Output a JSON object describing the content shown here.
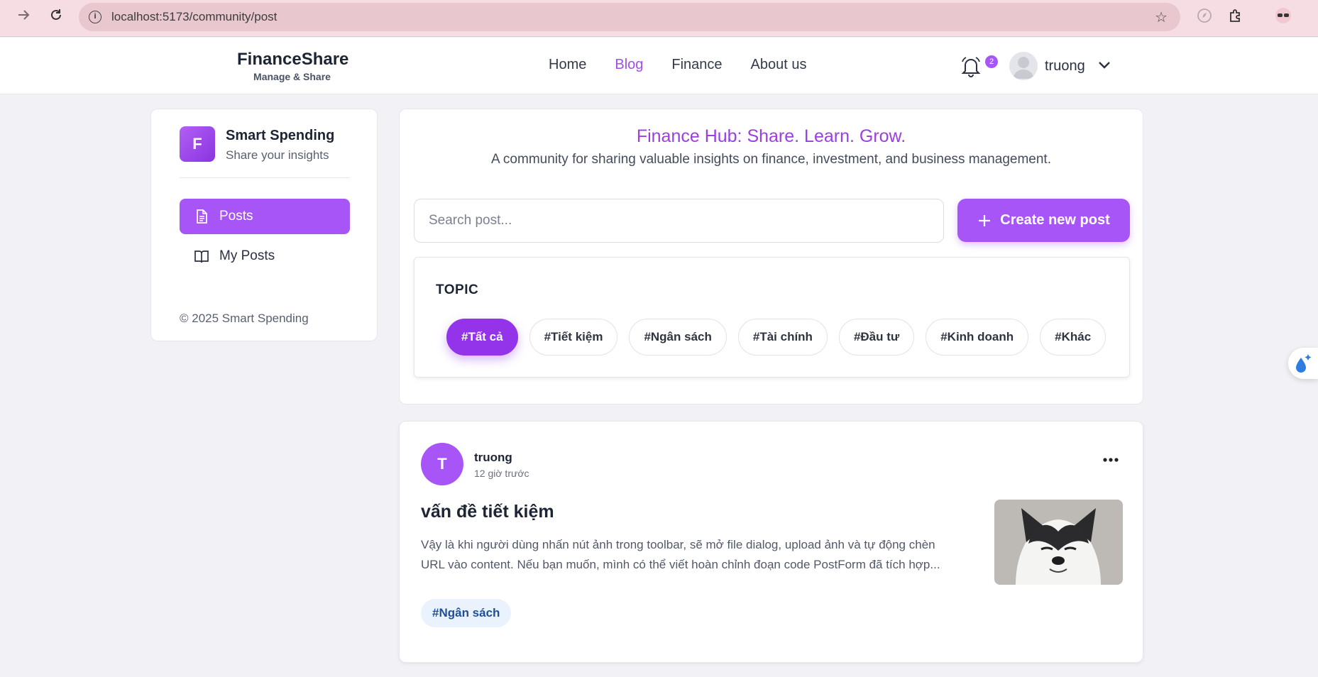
{
  "browser": {
    "url": "localhost:5173/community/post",
    "icons": [
      "forward-icon",
      "reload-icon",
      "site-info-icon",
      "bookmark-star-icon",
      "extension-icon",
      "puzzle-icon",
      "profile-icon"
    ]
  },
  "header": {
    "brand_name": "FinanceShare",
    "brand_tagline": "Manage & Share",
    "nav": [
      {
        "label": "Home",
        "active": false
      },
      {
        "label": "Blog",
        "active": true
      },
      {
        "label": "Finance",
        "active": false
      },
      {
        "label": "About us",
        "active": false
      }
    ],
    "notification_count": "2",
    "username": "truong"
  },
  "sidebar": {
    "logo_letter": "F",
    "title": "Smart Spending",
    "subtitle": "Share your insights",
    "items": [
      {
        "label": "Posts",
        "icon": "document-icon",
        "active": true
      },
      {
        "label": "My Posts",
        "icon": "open-book-icon",
        "active": false
      }
    ],
    "footer": "© 2025 Smart Spending"
  },
  "hero": {
    "title": "Finance Hub: Share. Learn. Grow.",
    "subtitle": "A community for sharing valuable insights on finance, investment, and business management.",
    "search_placeholder": "Search post...",
    "create_label": "Create new post",
    "topic_label": "TOPIC",
    "topics": [
      "#Tất cả",
      "#Tiết kiệm",
      "#Ngân sách",
      "#Tài chính",
      "#Đầu tư",
      "#Kinh doanh",
      "#Khác"
    ],
    "active_topic": "#Tất cả"
  },
  "post": {
    "avatar_letter": "T",
    "author": "truong",
    "time": "12 giờ trước",
    "title": "vấn đề tiết kiệm",
    "excerpt": "Vậy là khi người dùng nhấn nút ảnh trong toolbar, sẽ mở file dialog, upload ảnh và tự động chèn URL vào content. Nếu bạn muốn, mình có thể viết hoàn chỉnh đoạn code PostForm đã tích hợp...",
    "tag": "#Ngân sách",
    "more_icon": "more-horizontal-icon"
  },
  "colors": {
    "accent": "#a855f7",
    "accent_dark": "#9333ea",
    "hero_title": "#9b3fe0",
    "background": "#f2f2f6"
  }
}
